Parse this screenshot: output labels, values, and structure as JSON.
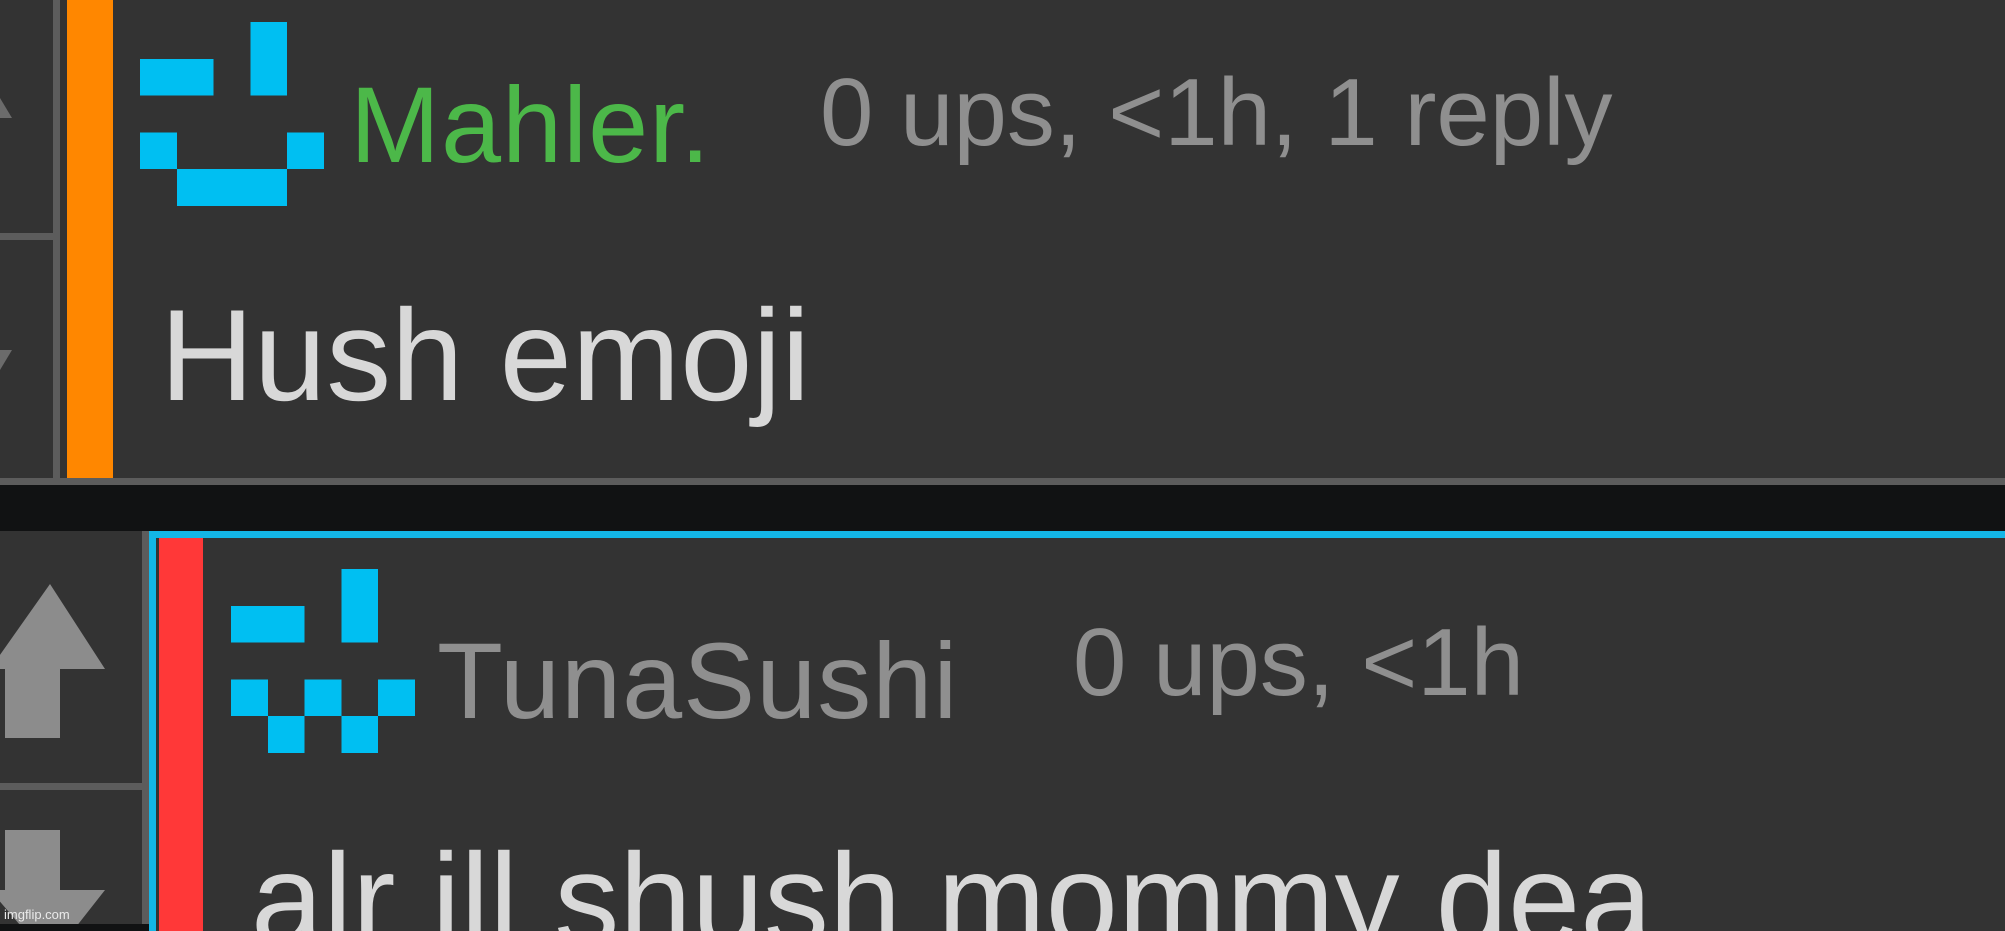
{
  "colors": {
    "panel": "#333333",
    "divider": "#5c5c5c",
    "avatar": "#00bff2",
    "green_name": "#4cb849",
    "meta": "#8f8f8f",
    "body": "#d8d8d8",
    "bar_orange": "#ff8700",
    "bar_red": "#ff3838",
    "highlight": "#13b6e6"
  },
  "comments": [
    {
      "username": "Mahler.",
      "meta": "0 ups, <1h, 1 reply",
      "text": "Hush emoji",
      "avatar_icon": "pixel-smiley-icon"
    },
    {
      "username": "TunaSushi",
      "meta": "0 ups, <1h",
      "text": "alr ill shush mommy dea",
      "avatar_icon": "pixel-smiley-icon"
    }
  ],
  "watermark": "imgflip.com"
}
